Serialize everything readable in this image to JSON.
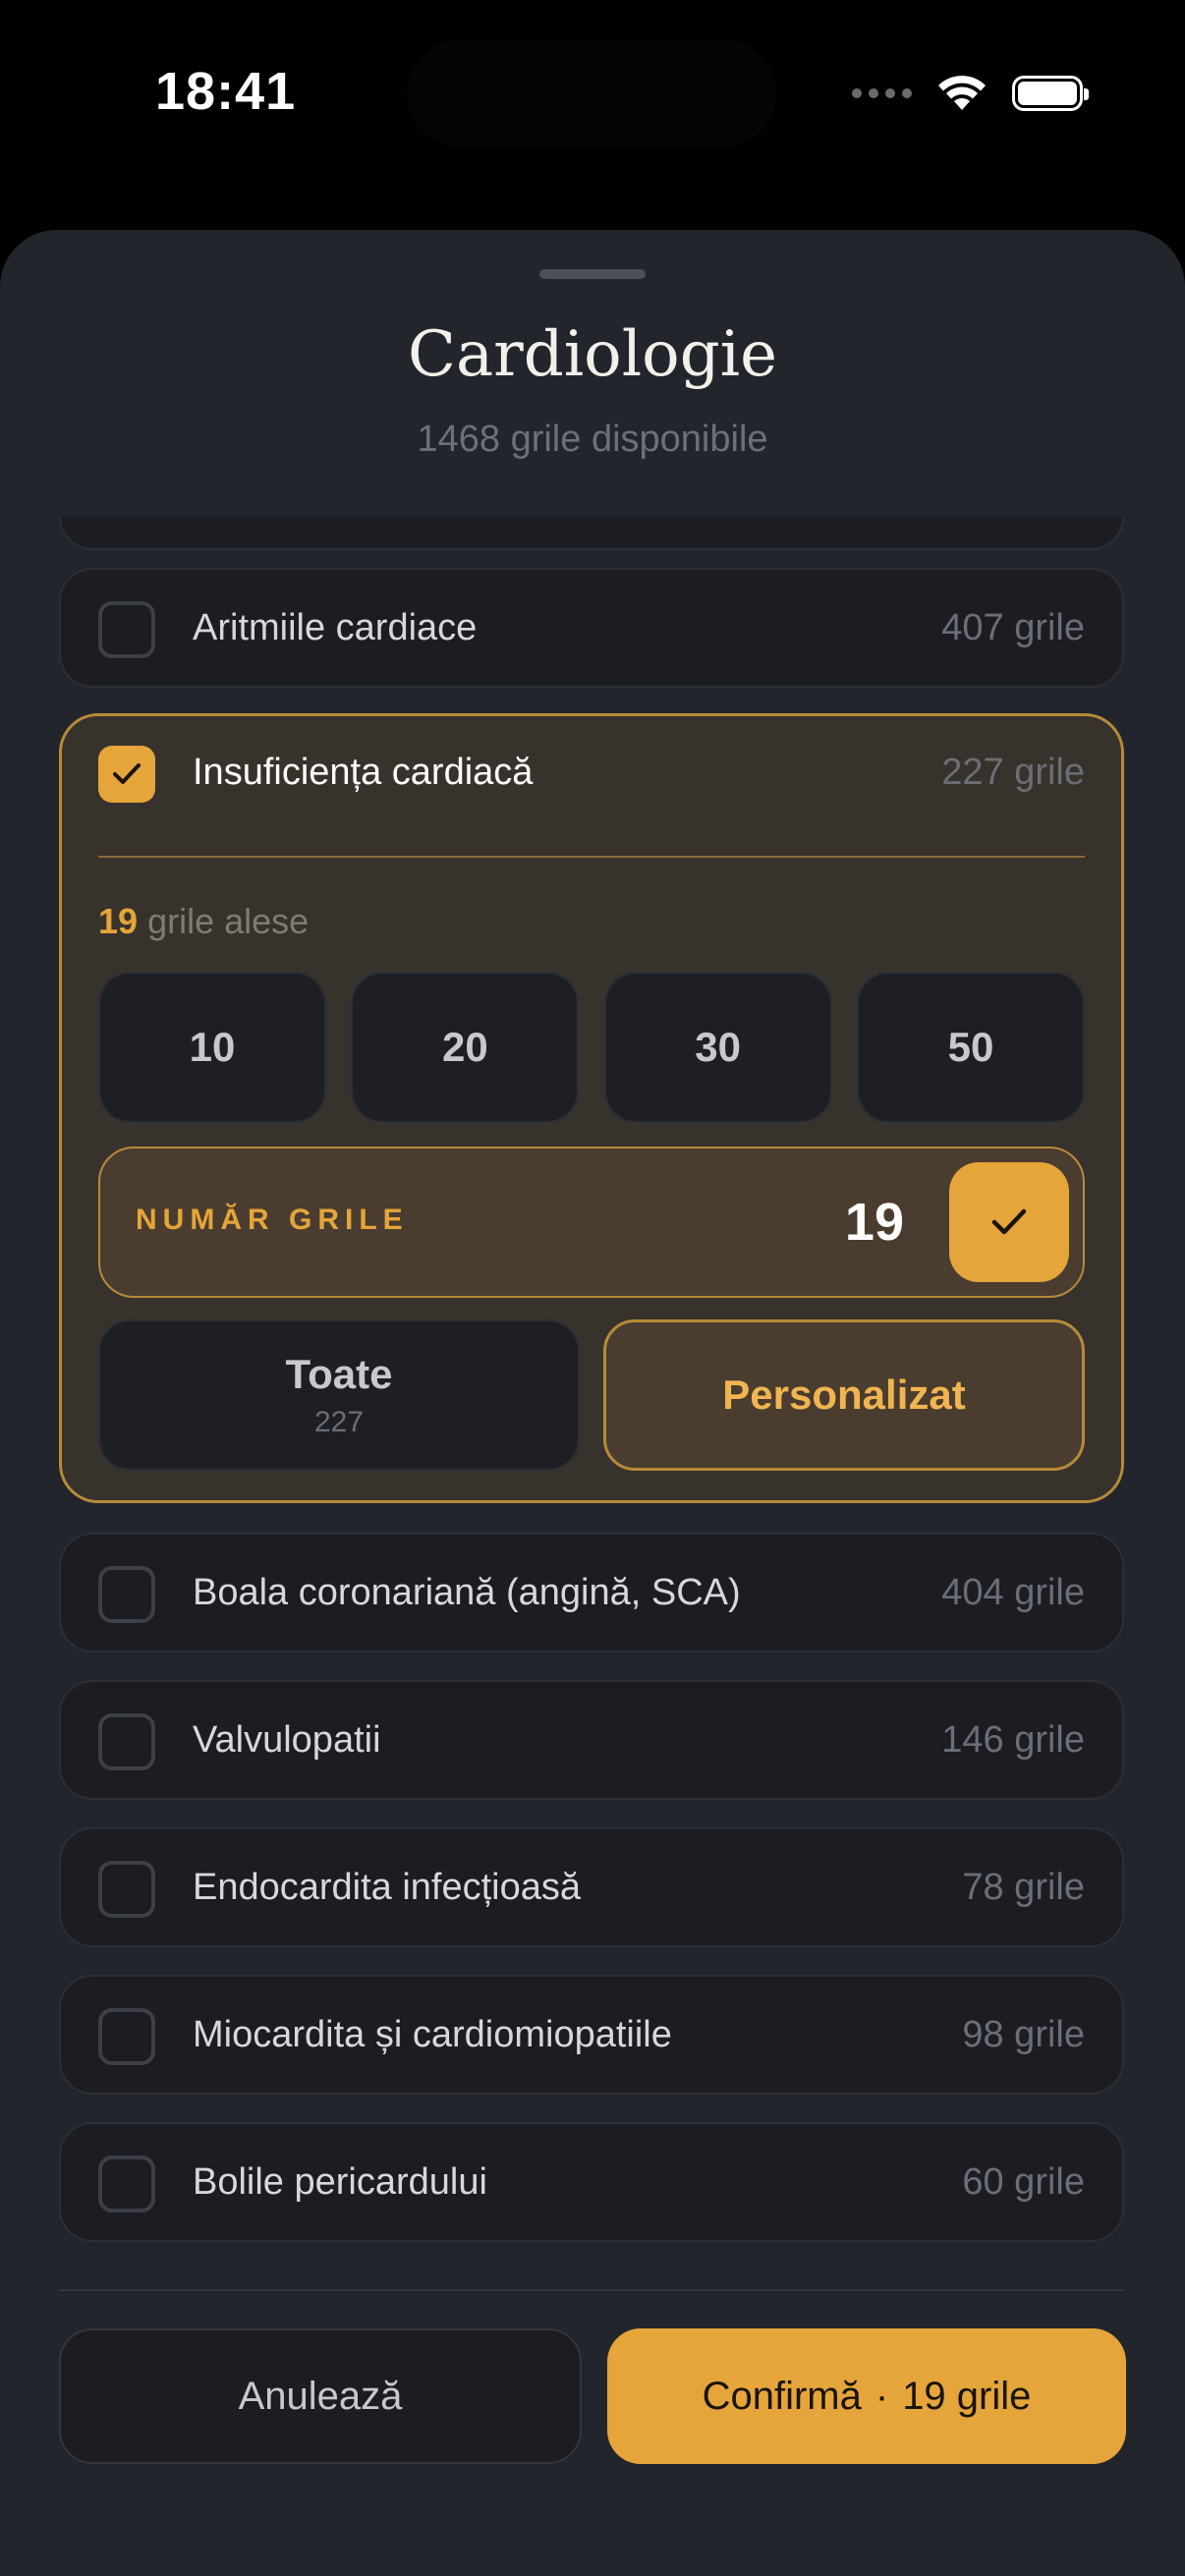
{
  "status_bar": {
    "time": "18:41"
  },
  "sheet": {
    "title": "Cardiologie",
    "subtitle": "1468 grile disponibile"
  },
  "topics_before": [
    {
      "label": "Aritmiile cardiace",
      "count": "407 grile",
      "checked": false
    }
  ],
  "selected_topic": {
    "label": "Insuficiența cardiacă",
    "count": "227 grile",
    "checked": true,
    "chosen_count": "19",
    "chosen_label": "grile alese",
    "presets": [
      "10",
      "20",
      "30",
      "50"
    ],
    "number_field": {
      "label": "NUMĂR GRILE",
      "value": "19"
    },
    "mode_all": {
      "label": "Toate",
      "count": "227"
    },
    "mode_custom": {
      "label": "Personalizat"
    }
  },
  "topics_after": [
    {
      "label": "Boala coronariană (angină, SCA)",
      "count": "404 grile",
      "checked": false
    },
    {
      "label": "Valvulopatii",
      "count": "146 grile",
      "checked": false
    },
    {
      "label": "Endocardita infecțioasă",
      "count": "78 grile",
      "checked": false
    },
    {
      "label": "Miocardita și cardiomiopatiile",
      "count": "98 grile",
      "checked": false
    },
    {
      "label": "Bolile pericardului",
      "count": "60 grile",
      "checked": false
    }
  ],
  "footer": {
    "cancel_label": "Anulează",
    "confirm_label": "Confirmă",
    "confirm_separator": "·",
    "confirm_count": "19 grile"
  },
  "colors": {
    "accent": "#e5a53a",
    "sheet_bg": "#22252c",
    "row_bg": "#1b1d22",
    "selected_bg": "#38322c"
  },
  "icons": {
    "checkmark": "check-icon",
    "wifi": "wifi-icon",
    "battery": "battery-icon",
    "cellular": "cellular-dots-icon"
  }
}
